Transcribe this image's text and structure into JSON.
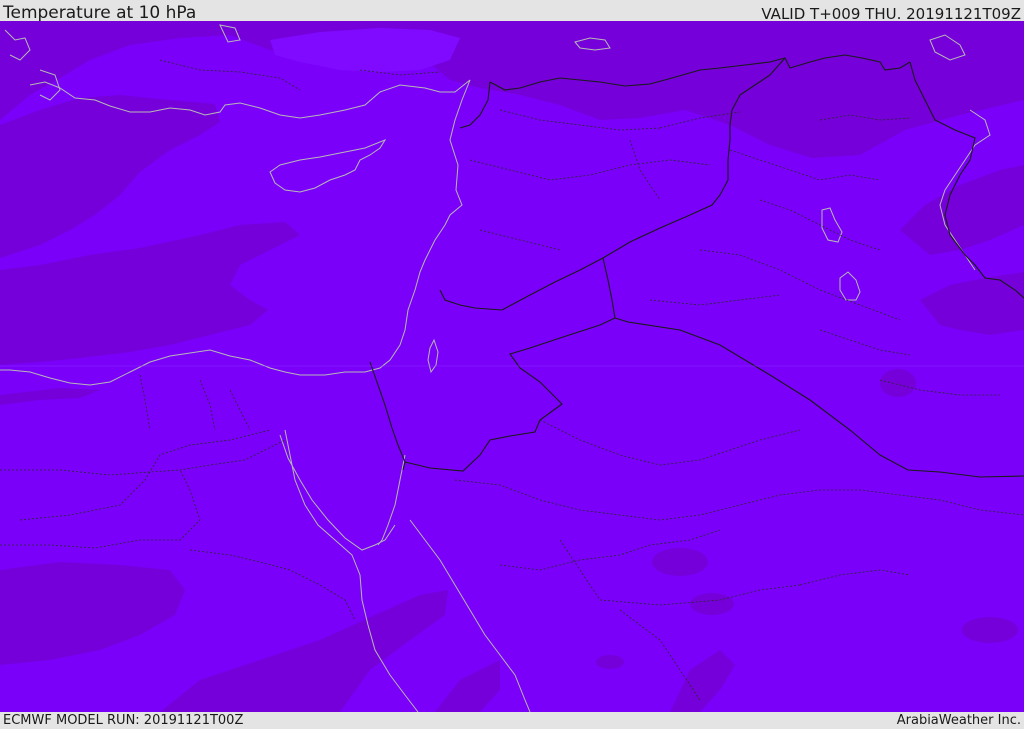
{
  "header": {
    "title": "Temperature at 10 hPa",
    "valid": "VALID T+009 THU. 20191121T09Z"
  },
  "footer": {
    "model_run": "ECMWF MODEL RUN: 20191121T00Z",
    "credit": "ArabiaWeather Inc."
  },
  "map": {
    "field": "temperature-10hpa",
    "colors": {
      "background": "#e4e4e4",
      "field_main": "#7a00fa",
      "field_dark": "#7500da",
      "field_light": "#7f0aff",
      "border_solid": "#1a1a1a",
      "border_dotted": "#2a2a2a",
      "coastline": "#b7b7b7"
    }
  }
}
